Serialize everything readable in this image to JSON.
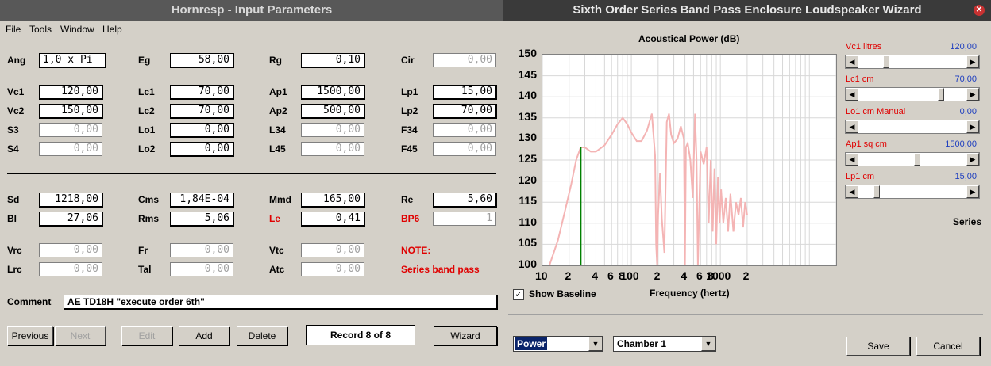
{
  "left_window": {
    "title": "Hornresp - Input Parameters",
    "menu": [
      "File",
      "Tools",
      "Window",
      "Help"
    ],
    "fields": {
      "Ang": "1,0 x Pi",
      "Eg": "58,00",
      "Rg": "0,10",
      "Cir": "0,00",
      "Vc1": "120,00",
      "Lc1": "70,00",
      "Ap1": "1500,00",
      "Lp1": "15,00",
      "Vc2": "150,00",
      "Lc2": "70,00",
      "Ap2": "500,00",
      "Lp2": "70,00",
      "S3": "0,00",
      "Lo1": "0,00",
      "L34": "0,00",
      "F34": "0,00",
      "S4": "0,00",
      "Lo2": "0,00",
      "L45": "0,00",
      "F45": "0,00",
      "Sd": "1218,00",
      "Cms": "1,84E-04",
      "Mmd": "165,00",
      "Re": "5,60",
      "Bl": "27,06",
      "Rms": "5,06",
      "Le": "0,41",
      "BP6": "1",
      "Vrc": "0,00",
      "Fr": "0,00",
      "Vtc": "0,00",
      "Lrc": "0,00",
      "Tal": "0,00",
      "Atc": "0,00"
    },
    "note_label": "NOTE:",
    "note_text": "Series band pass",
    "comment_label": "Comment",
    "comment_value": "AE TD18H \"execute order 6th\"",
    "buttons": {
      "previous": "Previous",
      "next": "Next",
      "edit": "Edit",
      "add": "Add",
      "delete": "Delete",
      "wizard": "Wizard"
    },
    "record": "Record 8 of 8"
  },
  "right_window": {
    "title": "Sixth Order Series Band Pass Enclosure Loudspeaker Wizard",
    "chart_title": "Acoustical Power (dB)",
    "xlabel": "Frequency (hertz)",
    "show_baseline_label": "Show Baseline",
    "show_baseline_checked": true,
    "sliders": [
      {
        "label": "Vc1  litres",
        "value": "120,00",
        "fraction": 0.24
      },
      {
        "label": "Lc1  cm",
        "value": "70,00",
        "fraction": 0.78
      },
      {
        "label": "Lo1  cm  Manual",
        "value": "0,00",
        "fraction": 0.0
      },
      {
        "label": "Ap1  sq cm",
        "value": "1500,00",
        "fraction": 0.55
      },
      {
        "label": "Lp1  cm",
        "value": "15,00",
        "fraction": 0.15
      }
    ],
    "series_label": "Series",
    "combo_power": "Power",
    "combo_chamber": "Chamber 1",
    "save": "Save",
    "cancel": "Cancel",
    "colors": {
      "curve": "#f4b4b4",
      "marker": "#008000",
      "grid": "#d8d8d8"
    }
  },
  "chart_data": {
    "type": "line",
    "title": "Acoustical Power (dB)",
    "xlabel": "Frequency (hertz)",
    "ylabel": "",
    "x_scale": "log",
    "xlim": [
      10,
      20000
    ],
    "ylim": [
      100,
      150
    ],
    "yticks": [
      100,
      105,
      110,
      115,
      120,
      125,
      130,
      135,
      140,
      145,
      150
    ],
    "xtick_labels": [
      "10",
      "2",
      "4",
      "6",
      "8",
      "100",
      "2",
      "4",
      "6",
      "8",
      "1000",
      "2"
    ],
    "xtick_values": [
      10,
      20,
      40,
      60,
      80,
      100,
      200,
      400,
      600,
      800,
      1000,
      2000
    ],
    "marker_frequency": 27,
    "series": [
      {
        "x": [
          12,
          15,
          18,
          21,
          24,
          27,
          30,
          35,
          40,
          50,
          60,
          70,
          80,
          90,
          100,
          115,
          130,
          150,
          170,
          185,
          190,
          195,
          200,
          210,
          220,
          235,
          250,
          265,
          280,
          300,
          330,
          360,
          390,
          400,
          410,
          430,
          460,
          490,
          520,
          540,
          560,
          600,
          650,
          700,
          740,
          780,
          820,
          860,
          900,
          940,
          980,
          1020,
          1080,
          1150,
          1220,
          1300,
          1400,
          1500,
          1600,
          1700,
          1800,
          1900,
          2000
        ],
        "y": [
          100,
          106,
          113,
          119,
          125,
          128,
          128,
          127,
          127,
          128.5,
          131,
          133.5,
          135,
          133.5,
          131.5,
          129.5,
          129.5,
          132,
          136,
          126,
          105,
          100,
          112,
          122,
          111,
          103,
          134,
          136,
          131,
          129,
          130,
          133,
          130,
          100,
          128,
          129,
          125,
          116,
          136,
          125,
          100,
          127,
          124,
          128,
          110,
          125,
          108,
          123,
          105,
          121,
          110,
          118,
          110,
          116,
          108,
          117,
          108,
          115,
          112,
          116,
          109,
          115,
          112
        ]
      }
    ],
    "grid": true
  }
}
